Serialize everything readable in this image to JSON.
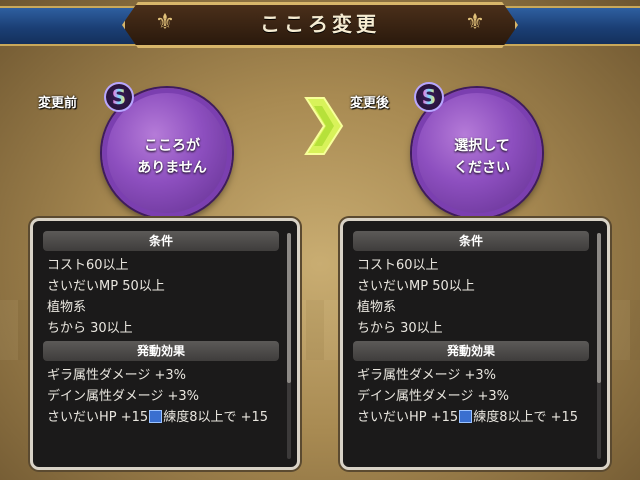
{
  "header": {
    "title": "こころ変更"
  },
  "before": {
    "label": "変更前",
    "rank": "S",
    "orb_text_line1": "こころが",
    "orb_text_line2": "ありません"
  },
  "after": {
    "label": "変更後",
    "rank": "S",
    "orb_text_line1": "選択して",
    "orb_text_line2": "ください"
  },
  "panels": [
    {
      "conditions_header": "条件",
      "conditions": [
        "コスト60以上",
        "さいだいMP 50以上",
        "植物系",
        "ちから 30以上"
      ],
      "effects_header": "発動効果",
      "effects": [
        "ギラ属性ダメージ +3%",
        "デイン属性ダメージ +3%"
      ],
      "effect_last_part1": "さいだいHP +15",
      "effect_last_part2": "練度8以上で +15"
    },
    {
      "conditions_header": "条件",
      "conditions": [
        "コスト60以上",
        "さいだいMP 50以上",
        "植物系",
        "ちから 30以上"
      ],
      "effects_header": "発動効果",
      "effects": [
        "ギラ属性ダメージ +3%",
        "デイン属性ダメージ +3%"
      ],
      "effect_last_part1": "さいだいHP +15",
      "effect_last_part2": "練度8以上で +15"
    }
  ],
  "colors": {
    "orb": "#8d4fbf",
    "header": "#1b3f75",
    "panel": "#1b1a1a"
  },
  "icons": [
    "fleur-icon",
    "right-arrow-icon",
    "rank-s-icon",
    "mastery-icon"
  ]
}
